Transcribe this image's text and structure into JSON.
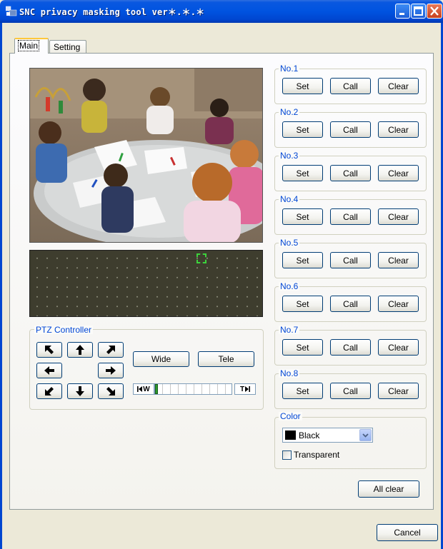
{
  "window": {
    "title": "SNC privacy masking tool ver＊.＊.＊",
    "icons": [
      "app-icon",
      "minimize-icon",
      "maximize-icon",
      "close-icon"
    ]
  },
  "tabs": [
    {
      "label": "Main",
      "selected": true
    },
    {
      "label": "Setting",
      "selected": false
    }
  ],
  "presets": [
    {
      "label": "No.1",
      "set": "Set",
      "call": "Call",
      "clear": "Clear"
    },
    {
      "label": "No.2",
      "set": "Set",
      "call": "Call",
      "clear": "Clear"
    },
    {
      "label": "No.3",
      "set": "Set",
      "call": "Call",
      "clear": "Clear"
    },
    {
      "label": "No.4",
      "set": "Set",
      "call": "Call",
      "clear": "Clear"
    },
    {
      "label": "No.5",
      "set": "Set",
      "call": "Call",
      "clear": "Clear"
    },
    {
      "label": "No.6",
      "set": "Set",
      "call": "Call",
      "clear": "Clear"
    },
    {
      "label": "No.7",
      "set": "Set",
      "call": "Call",
      "clear": "Clear"
    },
    {
      "label": "No.8",
      "set": "Set",
      "call": "Call",
      "clear": "Clear"
    }
  ],
  "ptz": {
    "title": "PTZ Controller",
    "wide": "Wide",
    "tele": "Tele",
    "zoom_min_label": "W",
    "zoom_max_label": "T",
    "zoom_level": 0.0
  },
  "color": {
    "title": "Color",
    "selected": "Black",
    "swatch": "#000000",
    "transparent_label": "Transparent",
    "transparent_checked": false
  },
  "buttons": {
    "all_clear": "All clear",
    "cancel": "Cancel"
  },
  "colors": {
    "titlebar": "#0053E0",
    "group_label": "#0046D5",
    "preview_bg": "#3E3D2E",
    "marker": "#3CD43C"
  }
}
